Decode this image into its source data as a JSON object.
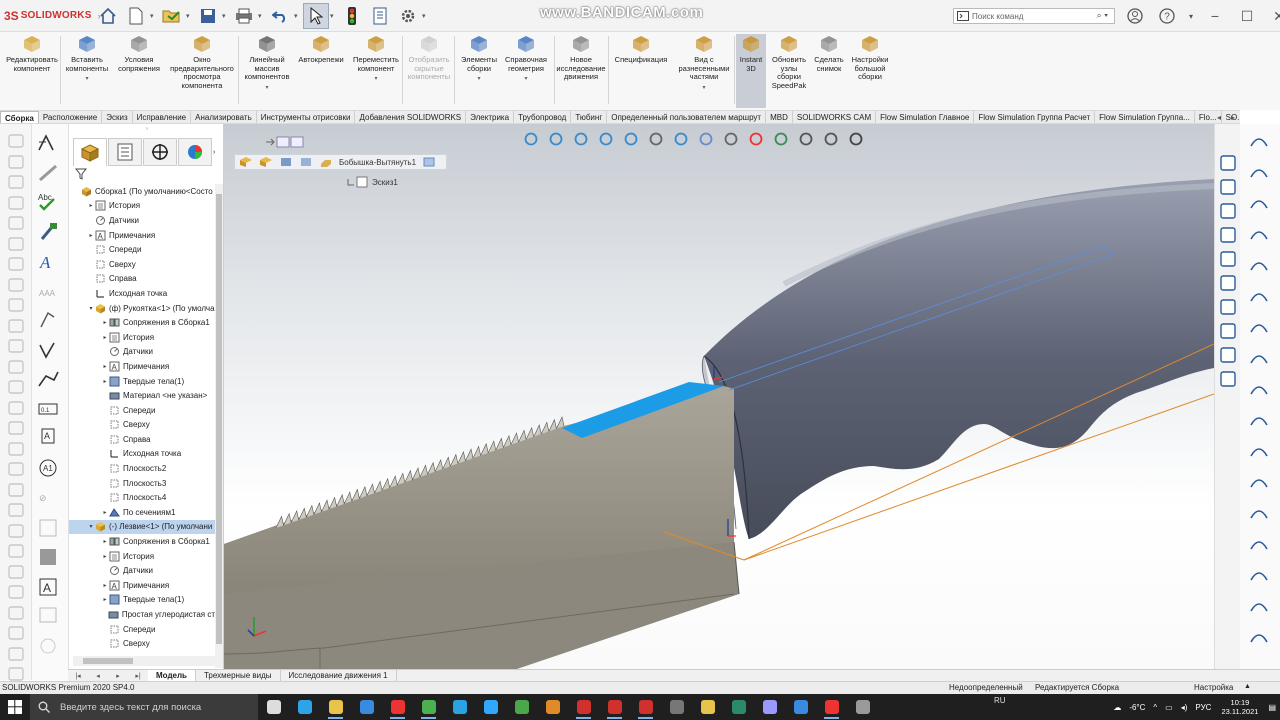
{
  "app": {
    "logo_ds": "3S",
    "logo_name": "SOLIDWORKS",
    "watermark": "www.BANDICAM.com",
    "search_placeholder": "Поиск команд",
    "accent": "#d0312d"
  },
  "commands": [
    {
      "label": "Редактировать\nкомпонент",
      "icon": "edit-component-icon"
    },
    {
      "label": "Вставить\nкомпоненты",
      "icon": "insert-components-icon",
      "dropdown": true
    },
    {
      "label": "Условия\nсопряжения",
      "icon": "mate-icon"
    },
    {
      "label": "Окно\nпредварительного\nпросмотра\nкомпонента",
      "icon": "preview-window-icon"
    },
    {
      "label": "Линейный\nмассив\nкомпонентов",
      "icon": "linear-pattern-icon",
      "dropdown": true
    },
    {
      "label": "Автокрепежи",
      "icon": "smart-fasteners-icon"
    },
    {
      "label": "Переместить\nкомпонент",
      "icon": "move-component-icon",
      "dropdown": true
    },
    {
      "label": "Отобразить\nскрытые\nкомпоненты",
      "icon": "show-hidden-icon",
      "disabled": true
    },
    {
      "label": "Элементы\nсборки",
      "icon": "assembly-features-icon",
      "dropdown": true
    },
    {
      "label": "Справочная\nгеометрия",
      "icon": "reference-geometry-icon",
      "dropdown": true
    },
    {
      "label": "Новое\nисследование\nдвижения",
      "icon": "motion-study-icon"
    },
    {
      "label": "Спецификация",
      "icon": "bom-icon"
    },
    {
      "label": "Вид с\nразнесенными\nчастями",
      "icon": "exploded-view-icon",
      "dropdown": true
    },
    {
      "label": "Instant\n3D",
      "icon": "instant3d-icon",
      "active": true
    },
    {
      "label": "Обновить\nузлы\nсборки\nSpeedPak",
      "icon": "speedpak-icon"
    },
    {
      "label": "Сделать\nснимок",
      "icon": "snapshot-icon"
    },
    {
      "label": "Настройки\nбольшой\nсборки",
      "icon": "large-assembly-icon"
    }
  ],
  "tabs": [
    "Сборка",
    "Расположение",
    "Эскиз",
    "Исправление",
    "Анализировать",
    "Инструменты отрисовки",
    "Добавления SOLIDWORKS",
    "Электрика",
    "Трубопровод",
    "Тюбинг",
    "Определенный пользователем маршрут",
    "MBD",
    "SOLIDWORKS CAM",
    "Flow Simulation Главное",
    "Flow Simulation Группа Расчет",
    "Flow Simulation Группа...",
    "Flo...",
    "SO...",
    "SO..."
  ],
  "tree": [
    {
      "label": "Сборка1  (По умолчанию<Состо",
      "indent": 0,
      "exp": "",
      "icon": "assembly-icon"
    },
    {
      "label": "История",
      "indent": 1,
      "exp": "▸",
      "icon": "history-icon"
    },
    {
      "label": "Датчики",
      "indent": 1,
      "exp": "",
      "icon": "sensor-icon"
    },
    {
      "label": "Примечания",
      "indent": 1,
      "exp": "▸",
      "icon": "annotation-icon"
    },
    {
      "label": "Спереди",
      "indent": 1,
      "exp": "",
      "icon": "plane-icon"
    },
    {
      "label": "Сверху",
      "indent": 1,
      "exp": "",
      "icon": "plane-icon"
    },
    {
      "label": "Справа",
      "indent": 1,
      "exp": "",
      "icon": "plane-icon"
    },
    {
      "label": "Исходная точка",
      "indent": 1,
      "exp": "",
      "icon": "origin-icon"
    },
    {
      "label": "(ф) Рукоятка<1> (По умолча",
      "indent": 1,
      "exp": "▾",
      "icon": "part-icon"
    },
    {
      "label": "Сопряжения в Сборка1",
      "indent": 2,
      "exp": "▸",
      "icon": "mates-icon"
    },
    {
      "label": "История",
      "indent": 2,
      "exp": "▸",
      "icon": "history-icon"
    },
    {
      "label": "Датчики",
      "indent": 2,
      "exp": "",
      "icon": "sensor-icon"
    },
    {
      "label": "Примечания",
      "indent": 2,
      "exp": "▸",
      "icon": "annotation-icon"
    },
    {
      "label": "Твердые тела(1)",
      "indent": 2,
      "exp": "▸",
      "icon": "solid-bodies-icon"
    },
    {
      "label": "Материал <не указан>",
      "indent": 2,
      "exp": "",
      "icon": "material-icon"
    },
    {
      "label": "Спереди",
      "indent": 2,
      "exp": "",
      "icon": "plane-icon"
    },
    {
      "label": "Сверху",
      "indent": 2,
      "exp": "",
      "icon": "plane-icon"
    },
    {
      "label": "Справа",
      "indent": 2,
      "exp": "",
      "icon": "plane-icon"
    },
    {
      "label": "Исходная точка",
      "indent": 2,
      "exp": "",
      "icon": "origin-icon"
    },
    {
      "label": "Плоскость2",
      "indent": 2,
      "exp": "",
      "icon": "plane-icon"
    },
    {
      "label": "Плоскость3",
      "indent": 2,
      "exp": "",
      "icon": "plane-icon"
    },
    {
      "label": "Плоскость4",
      "indent": 2,
      "exp": "",
      "icon": "plane-icon"
    },
    {
      "label": "По сечениям1",
      "indent": 2,
      "exp": "▸",
      "icon": "loft-icon"
    },
    {
      "label": "(-) Лезвие<1> (По умолчани",
      "indent": 1,
      "exp": "▾",
      "icon": "part-icon",
      "selected": true
    },
    {
      "label": "Сопряжения в Сборка1",
      "indent": 2,
      "exp": "▸",
      "icon": "mates-icon"
    },
    {
      "label": "История",
      "indent": 2,
      "exp": "▸",
      "icon": "history-icon"
    },
    {
      "label": "Датчики",
      "indent": 2,
      "exp": "",
      "icon": "sensor-icon"
    },
    {
      "label": "Примечания",
      "indent": 2,
      "exp": "▸",
      "icon": "annotation-icon"
    },
    {
      "label": "Твердые тела(1)",
      "indent": 2,
      "exp": "▸",
      "icon": "solid-bodies-icon"
    },
    {
      "label": "Простая углеродистая ст",
      "indent": 2,
      "exp": "",
      "icon": "material-icon"
    },
    {
      "label": "Спереди",
      "indent": 2,
      "exp": "",
      "icon": "plane-icon"
    },
    {
      "label": "Сверху",
      "indent": 2,
      "exp": "",
      "icon": "plane-icon"
    }
  ],
  "viewport": {
    "breadcrumb": "Бобышка-Вытянуть1",
    "sketch": "Эскиз1"
  },
  "bottom_tabs": [
    "Модель",
    "Трехмерные виды",
    "Исследование движения 1"
  ],
  "status": {
    "version": "SOLIDWORKS Premium 2020 SP4.0",
    "state": "Недоопределенный",
    "editing": "Редактируется Сборка",
    "custom": "Настройка"
  },
  "taskbar": {
    "search": "Введите здесь текст для поиска",
    "weather": "-6°C",
    "lang_ru": "RU",
    "lang": "РУС",
    "time": "10:19",
    "date": "23.11.2021"
  }
}
